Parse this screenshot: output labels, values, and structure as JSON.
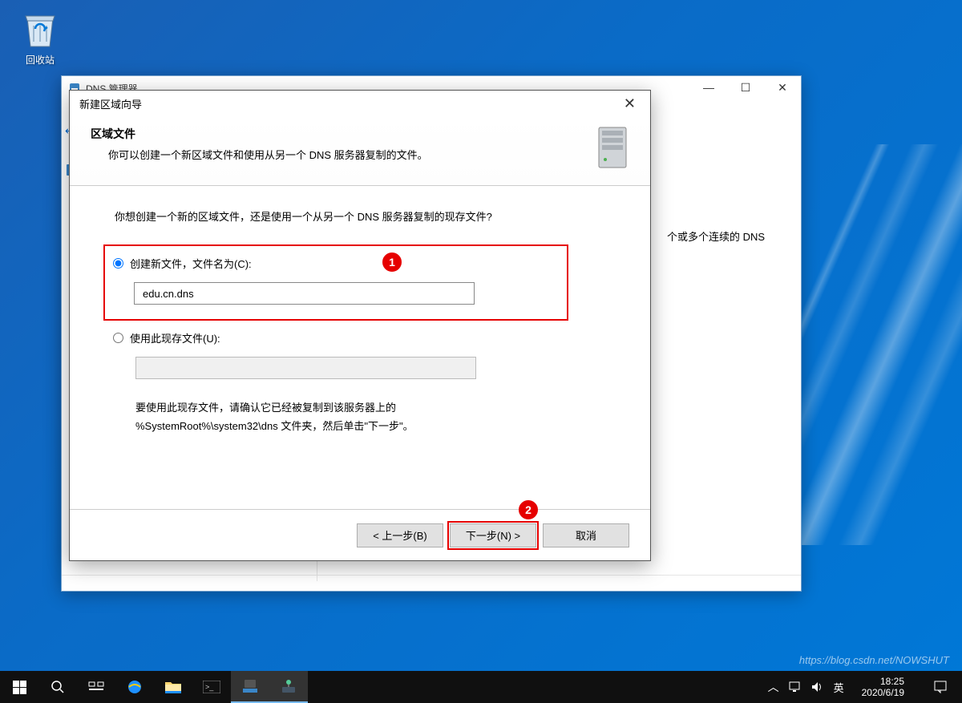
{
  "desktop": {
    "recycle_label": "回收站"
  },
  "bg_window": {
    "title": "DNS 管理器",
    "peek_text": "个或多个连续的 DNS"
  },
  "wizard": {
    "title": "新建区域向导",
    "heading": "区域文件",
    "subheading": "你可以创建一个新区域文件和使用从另一个 DNS 服务器复制的文件。",
    "question": "你想创建一个新的区域文件，还是使用一个从另一个 DNS 服务器复制的现存文件?",
    "radio_new": "创建新文件，文件名为(C):",
    "input_new": "edu.cn.dns",
    "radio_existing": "使用此现存文件(U):",
    "input_existing": "",
    "hint_line1": "要使用此现存文件，请确认它已经被复制到该服务器上的",
    "hint_line2": "%SystemRoot%\\system32\\dns 文件夹，然后单击\"下一步\"。",
    "btn_prev": "< 上一步(B)",
    "btn_next": "下一步(N) >",
    "btn_cancel": "取消",
    "badge1": "1",
    "badge2": "2"
  },
  "taskbar": {
    "ime": "英",
    "time": "18:25",
    "date": "2020/6/19"
  },
  "watermark": "https://blog.csdn.net/NOWSHUT"
}
